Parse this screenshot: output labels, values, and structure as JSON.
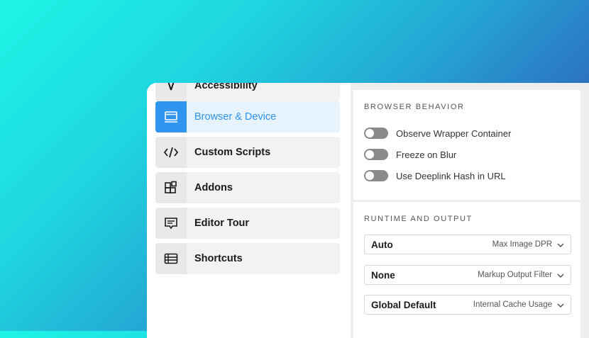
{
  "sidebar": {
    "items": [
      {
        "label": "Accessibility",
        "icon": "accessibility-icon"
      },
      {
        "label": "Browser & Device",
        "icon": "browser-window-icon",
        "active": true
      },
      {
        "label": "Custom Scripts",
        "icon": "code-icon"
      },
      {
        "label": "Addons",
        "icon": "addons-blocks-icon"
      },
      {
        "label": "Editor Tour",
        "icon": "speech-bubble-icon"
      },
      {
        "label": "Shortcuts",
        "icon": "list-icon"
      }
    ]
  },
  "browser_behavior": {
    "title": "BROWSER BEHAVIOR",
    "toggles": [
      {
        "label": "Observe Wrapper Container",
        "on": false
      },
      {
        "label": "Freeze on Blur",
        "on": false
      },
      {
        "label": "Use Deeplink Hash in URL",
        "on": false
      }
    ]
  },
  "runtime_output": {
    "title": "RUNTIME AND OUTPUT",
    "selects": [
      {
        "value": "Auto",
        "description": "Max Image DPR"
      },
      {
        "value": "None",
        "description": "Markup Output Filter"
      },
      {
        "value": "Global Default",
        "description": "Internal Cache Usage"
      }
    ]
  },
  "colors": {
    "accent": "#2f95ee",
    "active_bg": "#e6f2fc",
    "toggle_off": "#8a8a8a"
  }
}
